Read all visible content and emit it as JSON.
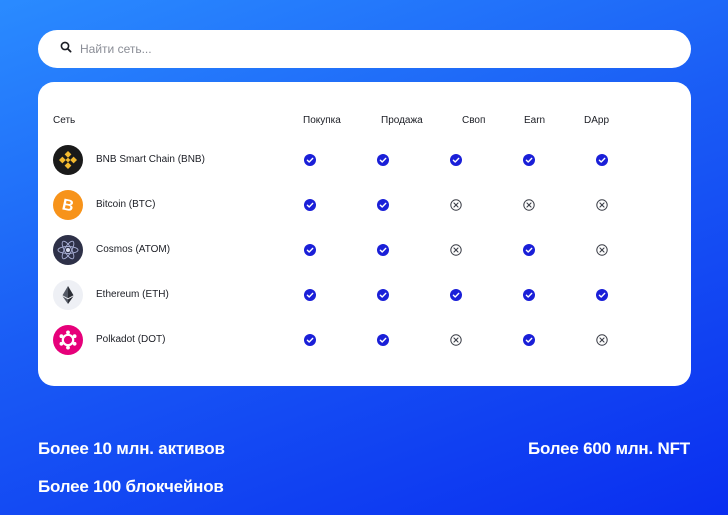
{
  "search": {
    "placeholder": "Найти сеть...",
    "value": ""
  },
  "table": {
    "headers": {
      "network": "Сеть",
      "buy": "Покупка",
      "sell": "Продажа",
      "swap": "Своп",
      "earn": "Earn",
      "dapp": "DApp"
    },
    "rows": [
      {
        "name": "BNB Smart Chain (BNB)",
        "icon": "bnb-icon",
        "color": "#1a1a1a",
        "buy": true,
        "sell": true,
        "swap": true,
        "earn": true,
        "dapp": true
      },
      {
        "name": "Bitcoin (BTC)",
        "icon": "bitcoin-icon",
        "color": "#f7931a",
        "buy": true,
        "sell": true,
        "swap": false,
        "earn": false,
        "dapp": false
      },
      {
        "name": "Cosmos (ATOM)",
        "icon": "cosmos-icon",
        "color": "#2e3148",
        "buy": true,
        "sell": true,
        "swap": false,
        "earn": true,
        "dapp": false
      },
      {
        "name": "Ethereum (ETH)",
        "icon": "ethereum-icon",
        "color": "#eef0f5",
        "buy": true,
        "sell": true,
        "swap": true,
        "earn": true,
        "dapp": true
      },
      {
        "name": "Polkadot (DOT)",
        "icon": "polkadot-icon",
        "color": "#e6007a",
        "buy": true,
        "sell": true,
        "swap": false,
        "earn": true,
        "dapp": false
      }
    ]
  },
  "stats": {
    "assets": "Более 10 млн. активов",
    "blockchains": "Более 100 блокчейнов",
    "nft": "Более 600 млн. NFT"
  },
  "colors": {
    "check": "#1a1fd8",
    "cross": "#3a3d46",
    "accent": "#1a5cf5"
  }
}
